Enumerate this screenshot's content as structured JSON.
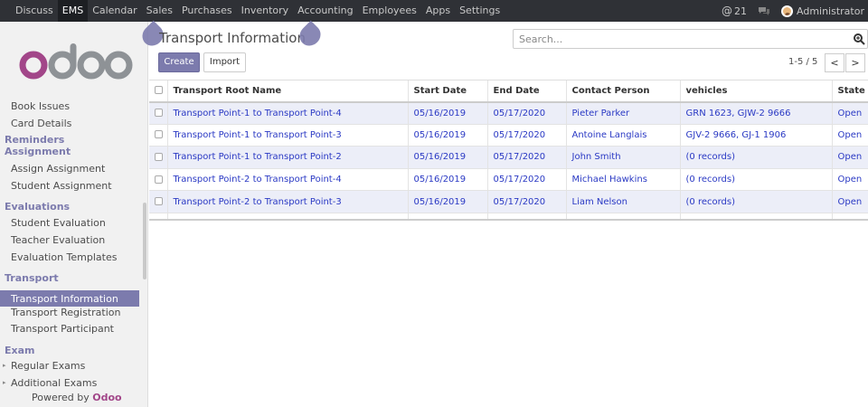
{
  "topbar": {
    "apps": [
      "Discuss",
      "EMS",
      "Calendar",
      "Sales",
      "Purchases",
      "Inventory",
      "Accounting",
      "Employees",
      "Apps",
      "Settings"
    ],
    "active_app": "EMS",
    "notification_count": "21",
    "user": "Administrator"
  },
  "sidebar": {
    "items": [
      {
        "type": "item",
        "label": "Book Issues"
      },
      {
        "type": "item",
        "label": "Card Details"
      },
      {
        "type": "head",
        "label": "Reminders"
      },
      {
        "type": "head",
        "label": "Assignment"
      },
      {
        "type": "item",
        "label": "Assign Assignment"
      },
      {
        "type": "item",
        "label": "Student Assignment"
      },
      {
        "type": "head",
        "label": "Evaluations"
      },
      {
        "type": "item",
        "label": "Student Evaluation"
      },
      {
        "type": "item",
        "label": "Teacher Evaluation"
      },
      {
        "type": "item",
        "label": "Evaluation Templates"
      },
      {
        "type": "head",
        "label": "Transport"
      },
      {
        "type": "active",
        "label": "Transport Information"
      },
      {
        "type": "item",
        "label": "Transport Registration"
      },
      {
        "type": "item",
        "label": "Transport Participant"
      },
      {
        "type": "head",
        "label": "Exam"
      },
      {
        "type": "collapsed",
        "label": "Regular Exams"
      },
      {
        "type": "collapsed",
        "label": "Additional Exams"
      }
    ],
    "powered_by": "Powered by",
    "powered_brand": "Odoo"
  },
  "control_panel": {
    "title": "Transport Information",
    "create_label": "Create",
    "import_label": "Import",
    "search_placeholder": "Search...",
    "pager": "1-5 / 5",
    "prev": "<",
    "next": ">"
  },
  "table": {
    "columns": [
      "Transport Root Name",
      "Start Date",
      "End Date",
      "Contact Person",
      "vehicles",
      "State"
    ],
    "rows": [
      [
        "Transport Point-1 to Transport Point-4",
        "05/16/2019",
        "05/17/2020",
        "Pieter Parker",
        "GRN 1623, GJW-2 9666",
        "Open"
      ],
      [
        "Transport Point-1 to Transport Point-3",
        "05/16/2019",
        "05/17/2020",
        "Antoine Langlais",
        "GJV-2 9666, GJ-1 1906",
        "Open"
      ],
      [
        "Transport Point-1 to Transport Point-2",
        "05/16/2019",
        "05/17/2020",
        "John Smith",
        "(0 records)",
        "Open"
      ],
      [
        "Transport Point-2 to Transport Point-4",
        "05/16/2019",
        "05/17/2020",
        "Michael Hawkins",
        "(0 records)",
        "Open"
      ],
      [
        "Transport Point-2 to Transport Point-3",
        "05/16/2019",
        "05/17/2020",
        "Liam Nelson",
        "(0 records)",
        "Open"
      ]
    ]
  },
  "colors": {
    "brand": "#7c7bad",
    "odoo_purple": "#a24689",
    "link": "#2a39c4",
    "topbar": "#2f3136"
  }
}
